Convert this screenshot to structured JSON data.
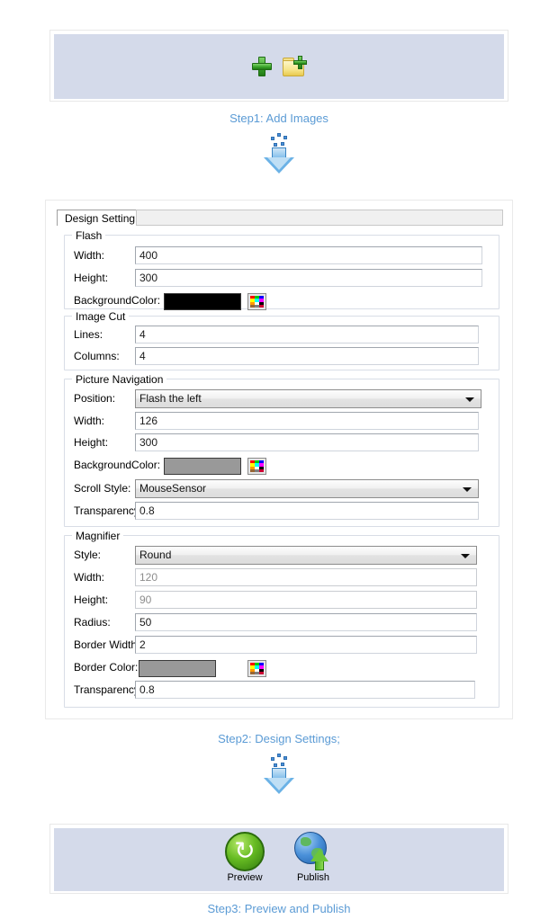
{
  "theme": {
    "panel_fill": "#d4daea",
    "caption_color": "#5b9bd5",
    "field_border": "#a0a6ae"
  },
  "step1": {
    "caption": "Step1: Add Images",
    "add_file_icon": "plus-icon",
    "add_folder_icon": "folder-add-icon"
  },
  "step2": {
    "caption": "Step2: Design Settings;",
    "tab_label": "Design Setting",
    "groups": {
      "flash": {
        "title": "Flash",
        "fields": [
          {
            "label": "Width:",
            "value": "400",
            "type": "text",
            "disabled": false
          },
          {
            "label": "Height:",
            "value": "300",
            "type": "text",
            "disabled": false
          },
          {
            "label": "BackgroundColor:",
            "value": "#000000",
            "type": "color",
            "disabled": false
          }
        ]
      },
      "image_cut": {
        "title": "Image Cut",
        "fields": [
          {
            "label": "Lines:",
            "value": "4",
            "type": "text",
            "disabled": false
          },
          {
            "label": "Columns:",
            "value": "4",
            "type": "text",
            "disabled": false
          }
        ]
      },
      "picture_navigation": {
        "title": "Picture Navigation",
        "fields": [
          {
            "label": "Position:",
            "value": "Flash the left",
            "type": "combo",
            "disabled": false
          },
          {
            "label": "Width:",
            "value": "126",
            "type": "text",
            "disabled": false
          },
          {
            "label": "Height:",
            "value": "300",
            "type": "text",
            "disabled": false
          },
          {
            "label": "BackgroundColor:",
            "value": "#999999",
            "type": "color",
            "disabled": false
          },
          {
            "label": "Scroll Style:",
            "value": "MouseSensor",
            "type": "combo",
            "disabled": false
          },
          {
            "label": "Transparency:",
            "value": "0.8",
            "type": "text",
            "disabled": false
          }
        ]
      },
      "magnifier": {
        "title": "Magnifier",
        "fields": [
          {
            "label": "Style:",
            "value": "Round",
            "type": "combo",
            "disabled": false
          },
          {
            "label": "Width:",
            "value": "120",
            "type": "text",
            "disabled": true
          },
          {
            "label": "Height:",
            "value": "90",
            "type": "text",
            "disabled": true
          },
          {
            "label": "Radius:",
            "value": "50",
            "type": "text",
            "disabled": false
          },
          {
            "label": "Border Width:",
            "value": "2",
            "type": "text",
            "disabled": false
          },
          {
            "label": "Border Color:",
            "value": "#999999",
            "type": "color",
            "disabled": false
          },
          {
            "label": "Transparency:",
            "value": "0.8",
            "type": "text",
            "disabled": false
          }
        ]
      }
    },
    "palette_colors": [
      "#ff0000",
      "#00cc00",
      "#0000ff",
      "#ffff00",
      "#00ffff",
      "#ff00ff",
      "#ff9900",
      "#ffffff",
      "#000000",
      "#996633",
      "#808080",
      "#cc0033"
    ]
  },
  "step3": {
    "caption": "Step3: Preview and Publish",
    "buttons": [
      {
        "label": "Preview",
        "icon": "refresh-circle-icon"
      },
      {
        "label": "Publish",
        "icon": "globe-upload-icon"
      }
    ]
  }
}
